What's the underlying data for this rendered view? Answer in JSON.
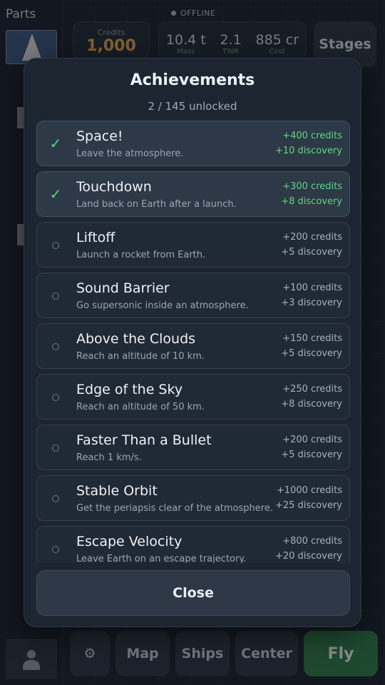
{
  "sidebar": {
    "title": "Parts"
  },
  "status": {
    "connection": "OFFLINE"
  },
  "header": {
    "credits_label": "Credits",
    "credits_value": "1,000",
    "stats": [
      {
        "value": "10.4 t",
        "label": "Mass"
      },
      {
        "value": "2.1",
        "label": "TWR"
      },
      {
        "value": "885 cr",
        "label": "Cost"
      }
    ],
    "stages_label": "Stages"
  },
  "bottom_nav": {
    "map": "Map",
    "ships": "Ships",
    "center": "Center",
    "fly": "Fly"
  },
  "modal": {
    "title": "Achievements",
    "subtitle": "2 / 145 unlocked",
    "close_label": "Close",
    "items": [
      {
        "name": "Space!",
        "desc": "Leave the atmosphere.",
        "reward_credits": "+400 credits",
        "reward_discovery": "+10 discovery",
        "unlocked": true
      },
      {
        "name": "Touchdown",
        "desc": "Land back on Earth after a launch.",
        "reward_credits": "+300 credits",
        "reward_discovery": "+8 discovery",
        "unlocked": true
      },
      {
        "name": "Liftoff",
        "desc": "Launch a rocket from Earth.",
        "reward_credits": "+200 credits",
        "reward_discovery": "+5 discovery",
        "unlocked": false
      },
      {
        "name": "Sound Barrier",
        "desc": "Go supersonic inside an atmosphere.",
        "reward_credits": "+100 credits",
        "reward_discovery": "+3 discovery",
        "unlocked": false
      },
      {
        "name": "Above the Clouds",
        "desc": "Reach an altitude of 10 km.",
        "reward_credits": "+150 credits",
        "reward_discovery": "+5 discovery",
        "unlocked": false
      },
      {
        "name": "Edge of the Sky",
        "desc": "Reach an altitude of 50 km.",
        "reward_credits": "+250 credits",
        "reward_discovery": "+8 discovery",
        "unlocked": false
      },
      {
        "name": "Faster Than a Bullet",
        "desc": "Reach 1 km/s.",
        "reward_credits": "+200 credits",
        "reward_discovery": "+5 discovery",
        "unlocked": false
      },
      {
        "name": "Stable Orbit",
        "desc": "Get the periapsis clear of the atmosphere.",
        "reward_credits": "+1000 credits",
        "reward_discovery": "+25 discovery",
        "unlocked": false
      },
      {
        "name": "Escape Velocity",
        "desc": "Leave Earth on an escape trajectory.",
        "reward_credits": "+800 credits",
        "reward_discovery": "+20 discovery",
        "unlocked": false
      }
    ]
  },
  "colors": {
    "accent_green": "#58d67c",
    "credits_gold": "#e3a64a",
    "fly_button": "#2f7a45"
  },
  "icons": [
    "check-icon",
    "circle-icon",
    "gear-icon",
    "user-icon"
  ]
}
